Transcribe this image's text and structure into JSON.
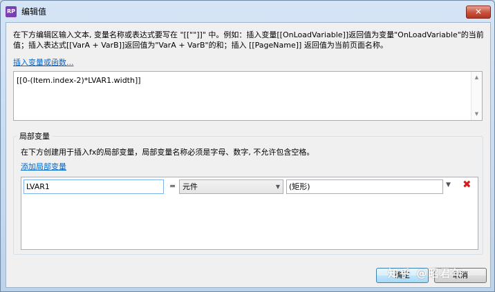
{
  "window": {
    "title": "编辑值",
    "app_icon_text": "RP",
    "close_glyph": "✕"
  },
  "description": "在下方编辑区输入文本, 变量名称或表达式要写在 \"[[\"\"]]\" 中。例如：插入变量[[OnLoadVariable]]返回值为变量\"OnLoadVariable\"的当前值；插入表达式[[VarA + VarB]]返回值为\"VarA + VarB\"的和；插入 [[PageName]] 返回值为当前页面名称。",
  "insert_link": "插入变量或函数...",
  "expression": "[[0-(Item.index-2)*LVAR1.width]]",
  "local_vars": {
    "title": "局部变量",
    "description": "在下方创建用于插入fx的局部变量，局部变量名称必须是字母、数字, 不允许包含空格。",
    "add_link": "添加局部变量",
    "rows": [
      {
        "name": "LVAR1",
        "equals": "=",
        "type": "元件",
        "target": "(矩形)"
      }
    ]
  },
  "buttons": {
    "ok": "确定",
    "cancel": "取消"
  },
  "watermark": "知乎 @昭君年",
  "icons": {
    "delete": "delete-icon",
    "dropdown": "chevron-down-icon",
    "scroll_up": "scroll-up-icon",
    "scroll_down": "scroll-down-icon"
  },
  "colors": {
    "link": "#0066cc",
    "delete": "#d91a1a",
    "close": "#c8513d"
  }
}
